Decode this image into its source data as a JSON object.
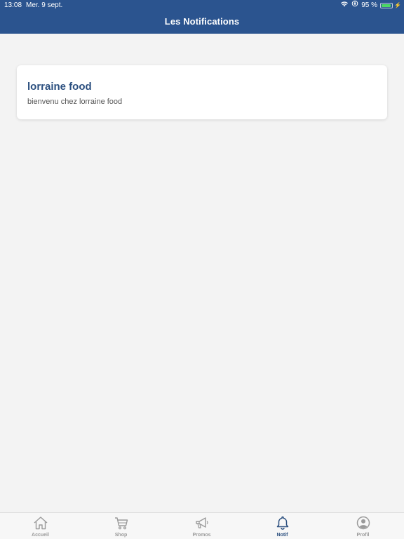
{
  "status_bar": {
    "time": "13:08",
    "date": "Mer. 9 sept.",
    "battery_percent": "95 %",
    "battery_level": 0.95,
    "battery_color": "#4cd964"
  },
  "header": {
    "title": "Les Notifications",
    "background": "#2b548f"
  },
  "notifications": [
    {
      "title": "lorraine food",
      "body": "bienvenu chez lorraine food"
    }
  ],
  "tabbar": {
    "active": "Notif",
    "accent": "#2b4f7f",
    "items": [
      {
        "label": "Accueil",
        "icon": "home-icon"
      },
      {
        "label": "Shop",
        "icon": "cart-icon"
      },
      {
        "label": "Promos",
        "icon": "megaphone-icon"
      },
      {
        "label": "Notif",
        "icon": "bell-icon"
      },
      {
        "label": "Profil",
        "icon": "user-circle-icon"
      }
    ]
  }
}
